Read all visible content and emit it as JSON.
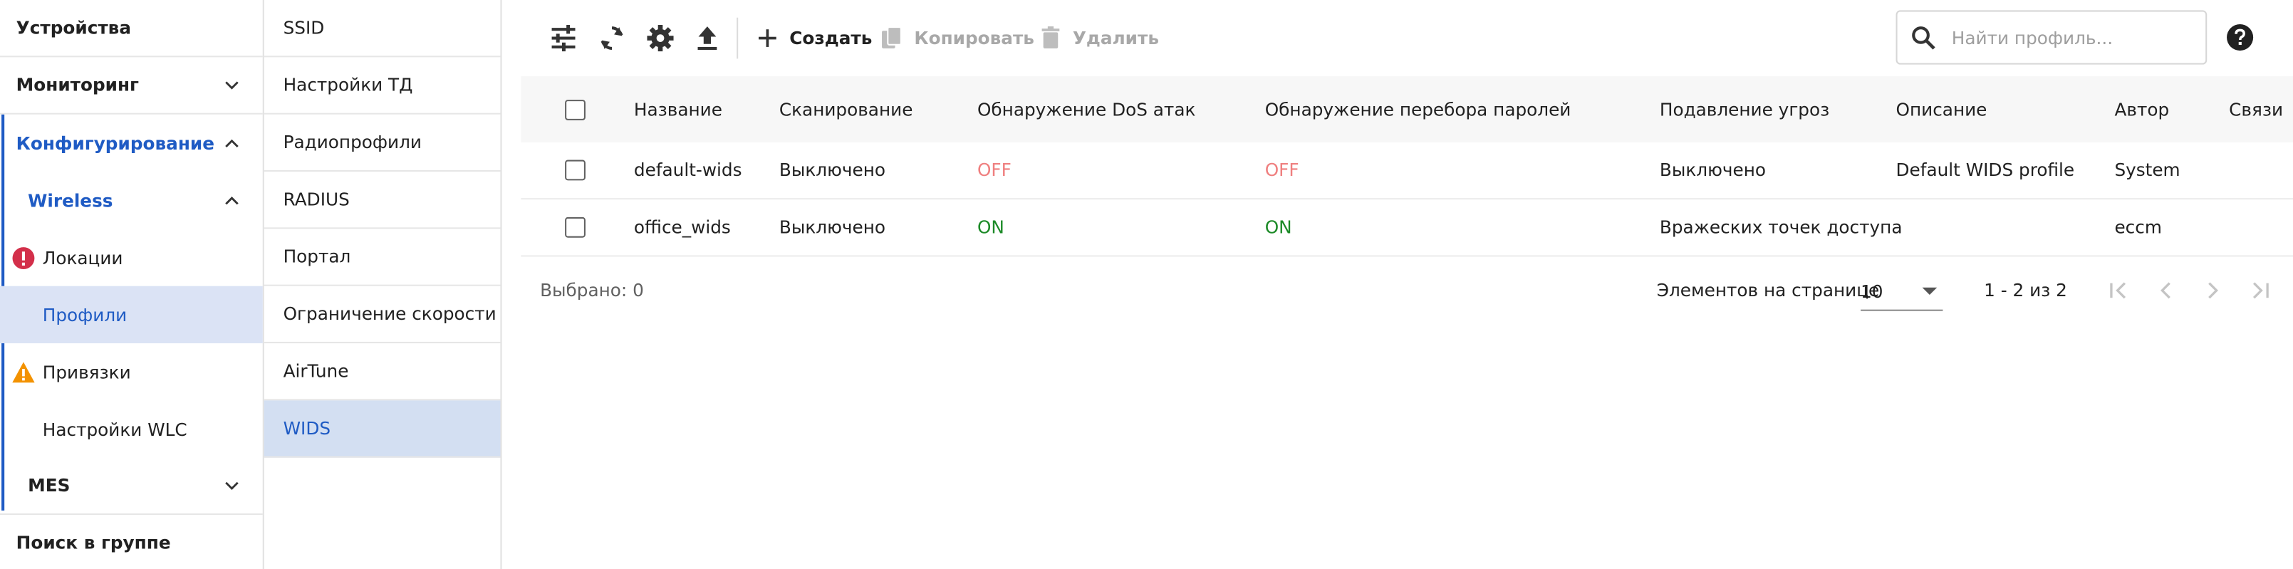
{
  "sidebar": {
    "devices": "Устройства",
    "monitoring": "Мониторинг",
    "configuring": "Конфигурирование",
    "wireless": "Wireless",
    "locations": "Локации",
    "profiles": "Профили",
    "bindings": "Привязки",
    "wlc_settings": "Настройки WLC",
    "mes": "MES",
    "group_search": "Поиск в группе"
  },
  "submenu": {
    "items": [
      "SSID",
      "Настройки ТД",
      "Радиопрофили",
      "RADIUS",
      "Портал",
      "Ограничение скорости",
      "AirTune",
      "WIDS"
    ],
    "selected": "WIDS"
  },
  "toolbar": {
    "create": "Создать",
    "copy": "Копировать",
    "delete": "Удалить",
    "search_placeholder": "Найти профиль..."
  },
  "table": {
    "headers": {
      "name": "Название",
      "scan": "Сканирование",
      "dos": "Обнаружение DoS атак",
      "brute": "Обнаружение перебора паролей",
      "threat": "Подавление угроз",
      "desc": "Описание",
      "author": "Автор",
      "links": "Связи"
    },
    "rows": [
      {
        "name": "default-wids",
        "scan": "Выключено",
        "dos": "OFF",
        "brute": "OFF",
        "threat": "Выключено",
        "desc": "Default WIDS profile",
        "author": "System",
        "links": ""
      },
      {
        "name": "office_wids",
        "scan": "Выключено",
        "dos": "ON",
        "brute": "ON",
        "threat": "Вражеских точек доступа",
        "desc": "",
        "author": "eccm",
        "links": ""
      }
    ]
  },
  "footer": {
    "selected": "Выбрано: 0",
    "per_page_label": "Элементов на странице",
    "per_page_value": "10",
    "range": "1 - 2 из 2"
  },
  "colors": {
    "accent": "#1f5bc4",
    "on": "#1c8a27",
    "off": "#ef7f7f",
    "error": "#d32f4a",
    "warning": "#f39200"
  }
}
